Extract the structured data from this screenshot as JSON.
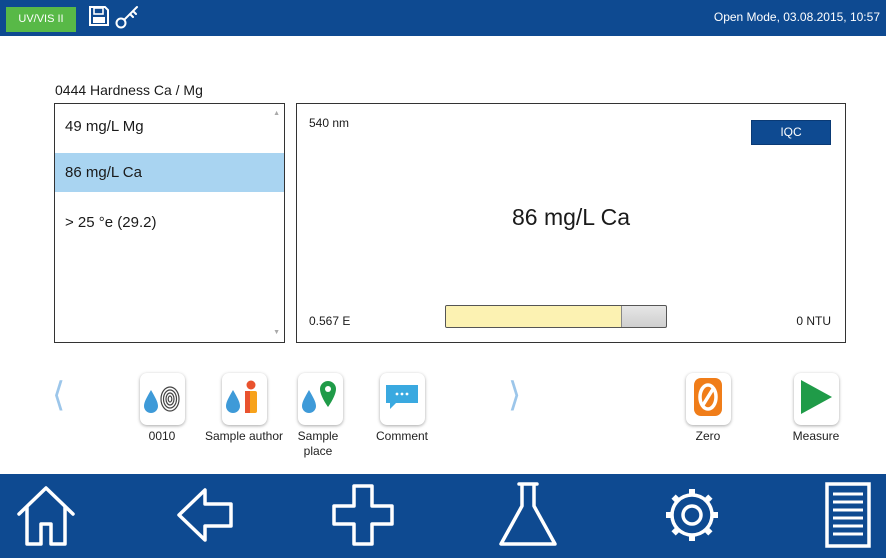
{
  "topbar": {
    "mode_badge": "UV/VIS II",
    "status": "Open Mode, 03.08.2015, 10:57",
    "icons": [
      "save-icon",
      "key-icon"
    ]
  },
  "method": {
    "title": "0444 Hardness Ca / Mg"
  },
  "results": {
    "items": [
      {
        "label": "49 mg/L Mg",
        "selected": false
      },
      {
        "label": "86 mg/L Ca",
        "selected": true
      },
      {
        "label": "> 25 °e (29.2)",
        "selected": false
      }
    ]
  },
  "measurement": {
    "wavelength": "540 nm",
    "iqc_label": "IQC",
    "main_result": "86 mg/L Ca",
    "extinction": "0.567 E",
    "turbidity": "0 NTU",
    "level_fraction": 0.8
  },
  "actions": {
    "items": [
      {
        "name": "sample-id",
        "label": "0010",
        "icon": "fingerprint-drop-icon"
      },
      {
        "name": "sample-author",
        "label": "Sample author",
        "icon": "person-drop-icon"
      },
      {
        "name": "sample-place",
        "label": "Sample place",
        "icon": "location-drop-icon"
      },
      {
        "name": "comment",
        "label": "Comment",
        "icon": "comment-icon"
      },
      {
        "name": "zero",
        "label": "Zero",
        "icon": "zero-icon"
      },
      {
        "name": "measure",
        "label": "Measure",
        "icon": "play-icon"
      }
    ],
    "prev_arrow": "⟨",
    "next_arrow": "⟩"
  },
  "bottom_nav": [
    "home-icon",
    "back-icon",
    "add-icon",
    "flask-icon",
    "settings-icon",
    "menu-icon"
  ],
  "colors": {
    "primary": "#0e4a91",
    "accent_green": "#58b947",
    "selection": "#a9d4f1",
    "drop_blue": "#3e9ad8",
    "zero_orange": "#f07d19",
    "measure_green": "#1f9b48"
  }
}
